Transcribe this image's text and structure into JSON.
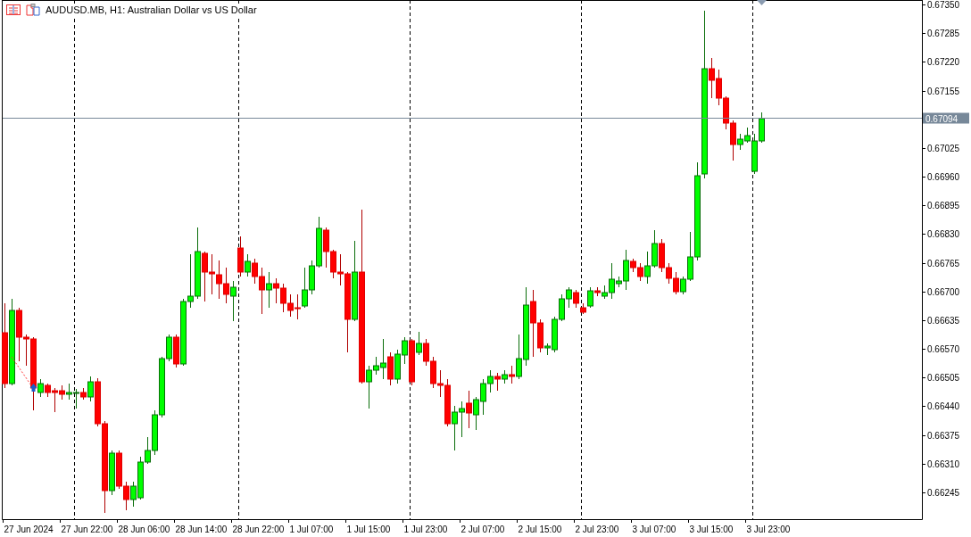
{
  "chart_title": "AUDUSD.MB, H1:  Australian Dollar vs US Dollar",
  "price_axis": {
    "labels": [
      "0.67350",
      "0.67285",
      "0.67220",
      "0.67155",
      "0.67025",
      "0.66960",
      "0.66895",
      "0.66830",
      "0.66765",
      "0.66700",
      "0.66635",
      "0.66570",
      "0.66505",
      "0.66440",
      "0.66375",
      "0.66310",
      "0.66245"
    ]
  },
  "time_axis": {
    "labels": [
      "27 Jun 2024",
      "27 Jun 22:00",
      "28 Jun 06:00",
      "28 Jun 14:00",
      "28 Jun 22:00",
      "1 Jul 07:00",
      "1 Jul 15:00",
      "1 Jul 23:00",
      "2 Jul 07:00",
      "2 Jul 15:00",
      "2 Jul 23:00",
      "3 Jul 07:00",
      "3 Jul 15:00",
      "3 Jul 23:00"
    ]
  },
  "price_line": {
    "label": "0.67094"
  }
}
